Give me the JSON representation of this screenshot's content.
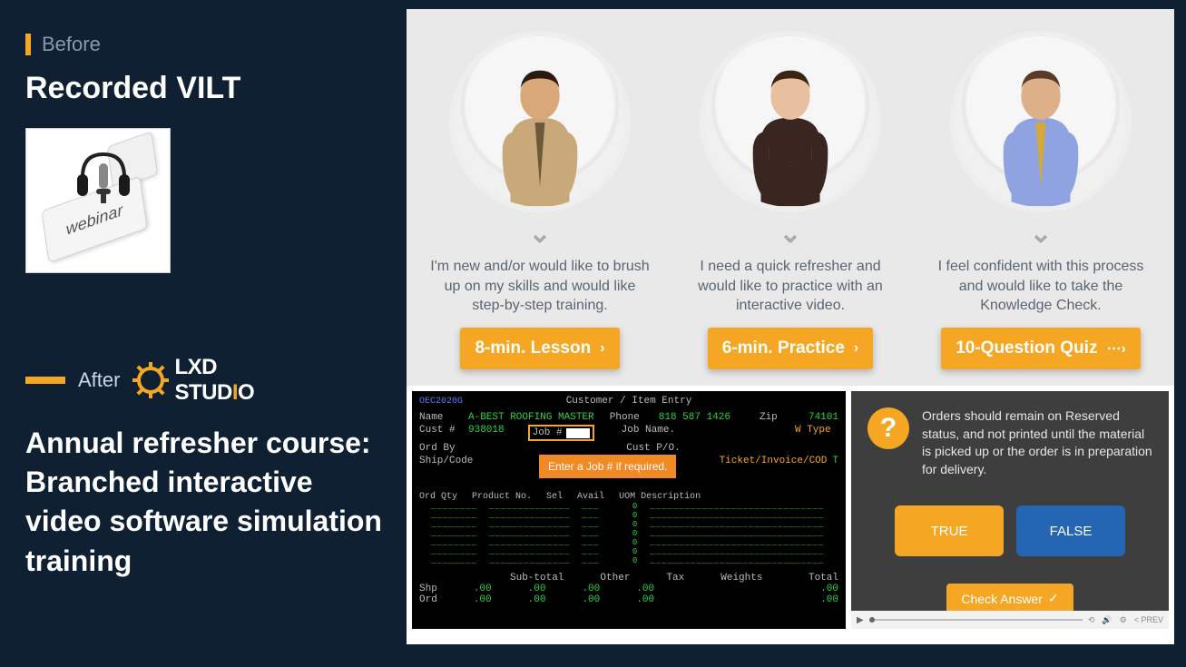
{
  "left": {
    "before_label": "Before",
    "before_title": "Recorded VILT",
    "webinar_label": "webinar",
    "after_label": "After",
    "logo": {
      "text_lxd": "LXD",
      "text_stud": "STUD",
      "text_i": "I",
      "text_o": "O"
    },
    "after_title": "Annual refresher course: Branched interactive video software simulation training"
  },
  "personas": [
    {
      "desc": "I'm new and/or would like to brush up on my skills and would like step-by-step training.",
      "button": "8-min. Lesson",
      "shirt": "#c9a87a",
      "tie": "#6b5a3a",
      "skin": "#d9a878",
      "hair": "#2a1a10"
    },
    {
      "desc": "I need a quick refresher and would like to practice with an interactive video.",
      "button": "6-min. Practice",
      "shirt": "#3a2620",
      "tie": "#3a2620",
      "skin": "#e8c0a0",
      "hair": "#3a2418"
    },
    {
      "desc": "I feel confident with this process and would like to take the Knowledge Check.",
      "button": "10-Question Quiz",
      "shirt": "#8fa3e0",
      "tie": "#d4a935",
      "skin": "#deb08a",
      "hair": "#5a3a28"
    }
  ],
  "terminal": {
    "code": "OEC2020G",
    "title": "Customer / Item Entry",
    "name_label": "Name",
    "name_val": "A-BEST ROOFING MASTER",
    "cust_label": "Cust #",
    "cust_val": "938018",
    "job_label": "Job #",
    "phone_label": "Phone",
    "phone_val": "818 587 1426",
    "zip_label": "Zip",
    "zip_val": "74101",
    "jobname_label": "Job Name.",
    "wtype_label": "W Type",
    "ordby_label": "Ord By",
    "custpo_label": "Cust P/O.",
    "ship_label": "Ship/Code",
    "ticket_label": "Ticket/Invoice/COD",
    "ticket_val": "T",
    "tooltip": "Enter a Job # if required.",
    "cols": {
      "qty": "Ord Qty",
      "prod": "Product No.",
      "sel": "Sel",
      "avail": "Avail",
      "uom": "UOM Description"
    },
    "zeros": [
      "0",
      "0",
      "0",
      "0",
      "0",
      "0",
      "0"
    ],
    "footer": {
      "subtotal": "Sub-total",
      "other": "Other",
      "tax": "Tax",
      "weights": "Weights",
      "total": "Total",
      "shp": "Shp",
      "ord": "Ord",
      "val": ".00"
    }
  },
  "quiz": {
    "question_mark": "?",
    "question": "Orders should remain on Reserved status, and not printed until the material is picked up or the order is in preparation for delivery.",
    "true_label": "TRUE",
    "false_label": "FALSE",
    "check_label": "Check Answer",
    "prev_label": "PREV"
  }
}
